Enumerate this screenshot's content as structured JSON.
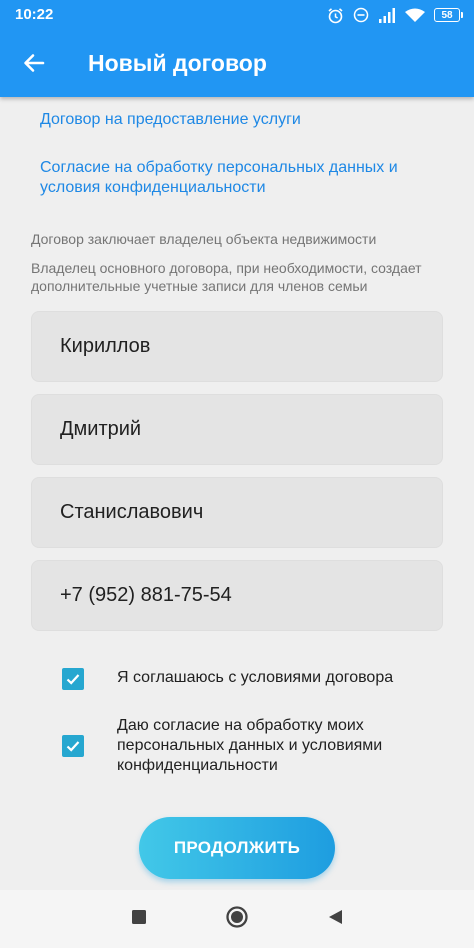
{
  "status_bar": {
    "time": "10:22",
    "battery": "58",
    "icons": [
      "alarm-icon",
      "do-not-disturb-icon",
      "signal-icon",
      "wifi-icon",
      "battery-icon"
    ]
  },
  "app_bar": {
    "title": "Новый договор",
    "back_icon": "arrow-left-icon",
    "color": "#2196f3"
  },
  "links": {
    "service_agreement": "Договор на предоставление услуги",
    "data_consent": "Согласие на обработку персональных данных и условия конфиденциальности"
  },
  "hints": {
    "owner": "Договор заключает владелец объекта недвижимости",
    "family": "Владелец основного договора, при необходимости, создает дополнительные учетные записи для членов семьи"
  },
  "form": {
    "last_name": "Кириллов",
    "first_name": "Дмитрий",
    "patronymic": "Станиславович",
    "phone": "+7 (952) 881-75-54"
  },
  "checkboxes": {
    "terms": {
      "label": "Я соглашаюсь с условиями договора",
      "checked": true
    },
    "privacy": {
      "label": "Даю согласие на обработку моих персональных данных и условиями конфиденциальности",
      "checked": true
    }
  },
  "continue_button": {
    "label": "ПРОДОЛЖИТЬ"
  },
  "nav_bar": {
    "icons": [
      "recents-square-icon",
      "home-circle-icon",
      "back-triangle-icon"
    ]
  }
}
